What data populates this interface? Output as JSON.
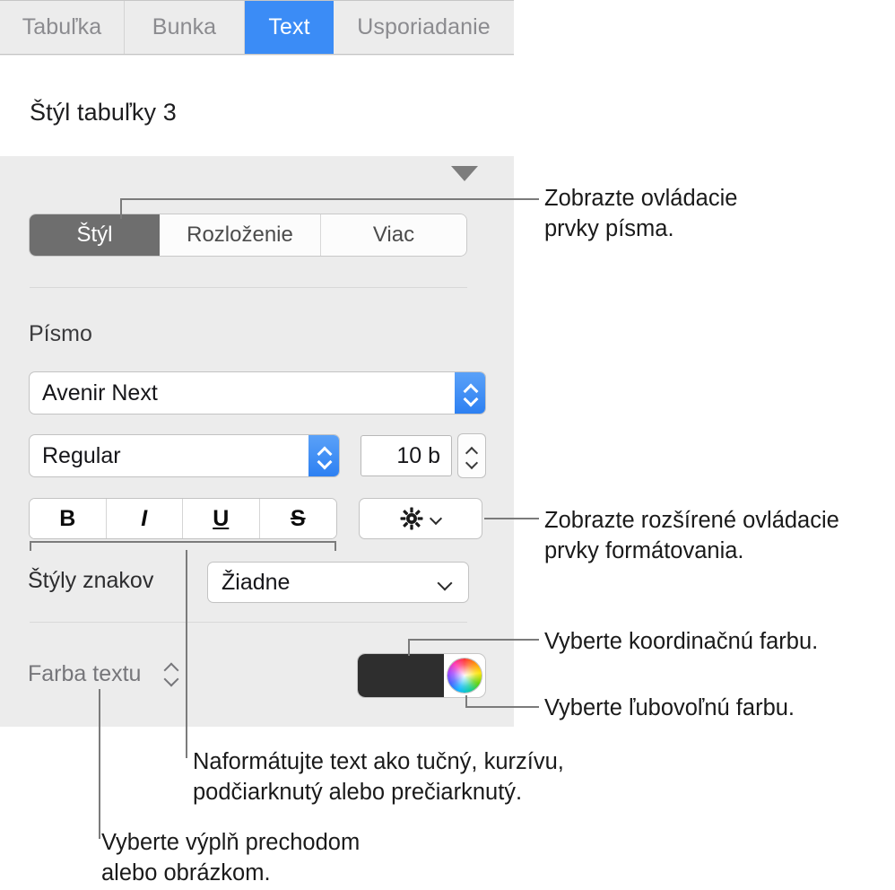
{
  "tabs": [
    {
      "label": "Tabuľka",
      "active": false
    },
    {
      "label": "Bunka",
      "active": false
    },
    {
      "label": "Text",
      "active": true
    },
    {
      "label": "Usporiadanie",
      "active": false
    }
  ],
  "style_title": "Štýl tabuľky 3",
  "segmented": [
    {
      "label": "Štýl",
      "active": true
    },
    {
      "label": "Rozloženie",
      "active": false
    },
    {
      "label": "Viac",
      "active": false
    }
  ],
  "font_section": {
    "label": "Písmo",
    "family_value": "Avenir Next",
    "style_value": "Regular",
    "size_value": "10 b",
    "text_styles": {
      "bold": "B",
      "italic": "I",
      "underline": "U",
      "strikethrough": "S"
    }
  },
  "character_styles": {
    "label": "Štýly znakov",
    "value": "Žiadne"
  },
  "text_color": {
    "label": "Farba textu",
    "swatch_color": "#2e2e2e"
  },
  "callouts": {
    "one": "Zobrazte ovládacie\nprvky písma.",
    "two": "Zobrazte rozšírené ovládacie\nprvky formátovania.",
    "three": "Vyberte koordinačnú farbu.",
    "four": "Vyberte ľubovoľnú farbu.",
    "five": "Naformátujte text ako tučný, kurzívu,\npodčiarknutý alebo prečiarknutý.",
    "six": "Vyberte výplň prechodom\nalebo obrázkom."
  },
  "colors": {
    "accent_blue": "#3b8cf6",
    "panel_bg": "#ececec",
    "segment_active": "#6e6e6e",
    "callout_line": "#7b7b7b"
  }
}
